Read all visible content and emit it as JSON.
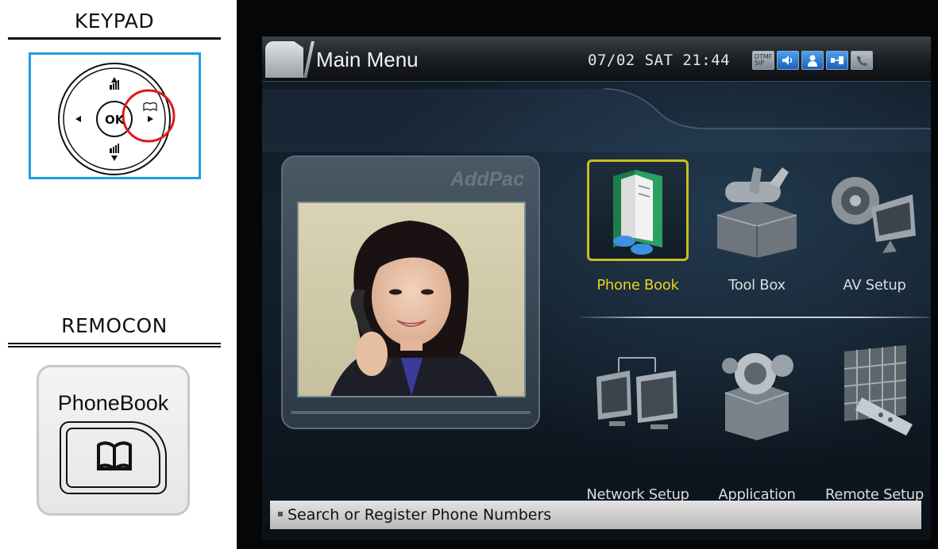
{
  "left_panel": {
    "keypad_title": "KEYPAD",
    "ok_label": "OK",
    "remocon_title": "REMOCON",
    "phonebook_key_label": "PhoneBook"
  },
  "screen": {
    "title": "Main Menu",
    "datetime": "07/02 SAT 21:44",
    "status_icons": [
      "dtmf-icon",
      "speaker-icon",
      "user-icon",
      "network-icon",
      "handset-icon"
    ],
    "brand": "AddPac",
    "menu_items": [
      {
        "label": "Phone Book",
        "icon": "phonebook-icon",
        "selected": true
      },
      {
        "label": "Tool Box",
        "icon": "toolbox-icon",
        "selected": false
      },
      {
        "label": "AV Setup",
        "icon": "av-setup-icon",
        "selected": false
      },
      {
        "label": "Network Setup",
        "icon": "network-setup-icon",
        "selected": false
      },
      {
        "label": "Application",
        "icon": "application-icon",
        "selected": false
      },
      {
        "label": "Remote Setup",
        "icon": "remote-setup-icon",
        "selected": false
      }
    ],
    "status_message": "Search or Register Phone Numbers",
    "colors": {
      "keypad_border": "#1e9ee6",
      "highlight_circle": "#e01818",
      "selected_label": "#ecd21a",
      "selected_border": "#c8be1e"
    }
  }
}
